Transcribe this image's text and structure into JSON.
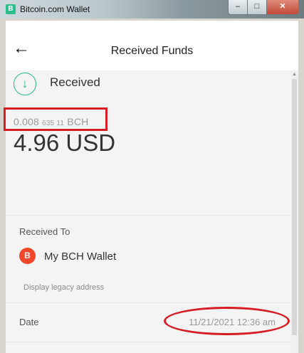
{
  "window": {
    "title": "Bitcoin.com Wallet",
    "icon_letter": "B",
    "minimize": "–",
    "maximize": "□",
    "close": "✕"
  },
  "header": {
    "title": "Received Funds",
    "back_icon": "←"
  },
  "summary": {
    "status_icon": "↓",
    "status_label": "Received",
    "crypto_main": "0.008",
    "crypto_small": "635 11",
    "crypto_unit": "BCH",
    "fiat_amount": "4.96 USD"
  },
  "received_to": {
    "label": "Received To",
    "wallet_icon_letter": "B",
    "wallet_name": "My BCH Wallet",
    "legacy_link": "Display legacy address"
  },
  "date": {
    "label": "Date",
    "value": "11/21/2021 12:36 am"
  },
  "colors": {
    "accent_green": "#2bb986",
    "bch_orange": "#f0462a",
    "annotation_red": "#d61d23"
  }
}
